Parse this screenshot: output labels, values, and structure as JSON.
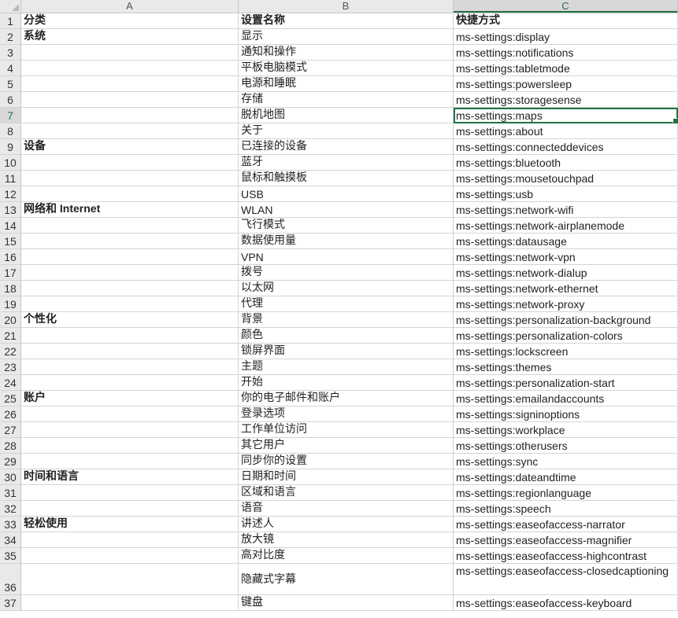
{
  "columns": [
    "A",
    "B",
    "C"
  ],
  "active_column": "C",
  "active_row": "7",
  "rows": [
    {
      "n": "1",
      "a": "分类",
      "b": "设置名称",
      "c": "快捷方式",
      "bold_a": true,
      "bold_bc": true
    },
    {
      "n": "2",
      "a": "系统",
      "b": "显示",
      "c": "ms-settings:display",
      "bold_a": true
    },
    {
      "n": "3",
      "a": "",
      "b": "通知和操作",
      "c": "ms-settings:notifications"
    },
    {
      "n": "4",
      "a": "",
      "b": "平板电脑模式",
      "c": "ms-settings:tabletmode"
    },
    {
      "n": "5",
      "a": "",
      "b": "电源和睡眠",
      "c": "ms-settings:powersleep"
    },
    {
      "n": "6",
      "a": "",
      "b": "存储",
      "c": "ms-settings:storagesense"
    },
    {
      "n": "7",
      "a": "",
      "b": "脱机地图",
      "c": "ms-settings:maps"
    },
    {
      "n": "8",
      "a": "",
      "b": "关于",
      "c": "ms-settings:about"
    },
    {
      "n": "9",
      "a": "设备",
      "b": "已连接的设备",
      "c": "ms-settings:connecteddevices",
      "bold_a": true
    },
    {
      "n": "10",
      "a": "",
      "b": "蓝牙",
      "c": "ms-settings:bluetooth"
    },
    {
      "n": "11",
      "a": "",
      "b": "鼠标和触摸板",
      "c": "ms-settings:mousetouchpad"
    },
    {
      "n": "12",
      "a": "",
      "b": "USB",
      "c": "ms-settings:usb"
    },
    {
      "n": "13",
      "a": "网络和 Internet",
      "b": "WLAN",
      "c": "ms-settings:network-wifi",
      "bold_a": true
    },
    {
      "n": "14",
      "a": "",
      "b": "飞行模式",
      "c": "ms-settings:network-airplanemode"
    },
    {
      "n": "15",
      "a": "",
      "b": "数据使用量",
      "c": "ms-settings:datausage"
    },
    {
      "n": "16",
      "a": "",
      "b": "VPN",
      "c": "ms-settings:network-vpn"
    },
    {
      "n": "17",
      "a": "",
      "b": "拨号",
      "c": "ms-settings:network-dialup"
    },
    {
      "n": "18",
      "a": "",
      "b": "以太网",
      "c": "ms-settings:network-ethernet"
    },
    {
      "n": "19",
      "a": "",
      "b": "代理",
      "c": "ms-settings:network-proxy"
    },
    {
      "n": "20",
      "a": "个性化",
      "b": "背景",
      "c": "ms-settings:personalization-background",
      "bold_a": true
    },
    {
      "n": "21",
      "a": "",
      "b": "颜色",
      "c": "ms-settings:personalization-colors"
    },
    {
      "n": "22",
      "a": "",
      "b": "锁屏界面",
      "c": "ms-settings:lockscreen"
    },
    {
      "n": "23",
      "a": "",
      "b": "主题",
      "c": "ms-settings:themes"
    },
    {
      "n": "24",
      "a": "",
      "b": "开始",
      "c": "ms-settings:personalization-start"
    },
    {
      "n": "25",
      "a": "账户",
      "b": "你的电子邮件和账户",
      "c": "ms-settings:emailandaccounts",
      "bold_a": true
    },
    {
      "n": "26",
      "a": "",
      "b": "登录选项",
      "c": "ms-settings:signinoptions"
    },
    {
      "n": "27",
      "a": "",
      "b": "工作单位访问",
      "c": "ms-settings:workplace"
    },
    {
      "n": "28",
      "a": "",
      "b": "其它用户",
      "c": "ms-settings:otherusers"
    },
    {
      "n": "29",
      "a": "",
      "b": "同步你的设置",
      "c": "ms-settings:sync"
    },
    {
      "n": "30",
      "a": "时间和语言",
      "b": "日期和时间",
      "c": "ms-settings:dateandtime",
      "bold_a": true
    },
    {
      "n": "31",
      "a": "",
      "b": "区域和语言",
      "c": "ms-settings:regionlanguage"
    },
    {
      "n": "32",
      "a": "",
      "b": "语音",
      "c": "ms-settings:speech"
    },
    {
      "n": "33",
      "a": "轻松使用",
      "b": "讲述人",
      "c": "ms-settings:easeofaccess-narrator",
      "bold_a": true
    },
    {
      "n": "34",
      "a": "",
      "b": "放大镜",
      "c": "ms-settings:easeofaccess-magnifier"
    },
    {
      "n": "35",
      "a": "",
      "b": "高对比度",
      "c": "ms-settings:easeofaccess-highcontrast"
    },
    {
      "n": "36",
      "a": "",
      "b": "隐藏式字幕",
      "c": "ms-settings:easeofaccess-closedcaptioning",
      "tall": true
    },
    {
      "n": "37",
      "a": "",
      "b": "键盘",
      "c": "ms-settings:easeofaccess-keyboard"
    }
  ]
}
